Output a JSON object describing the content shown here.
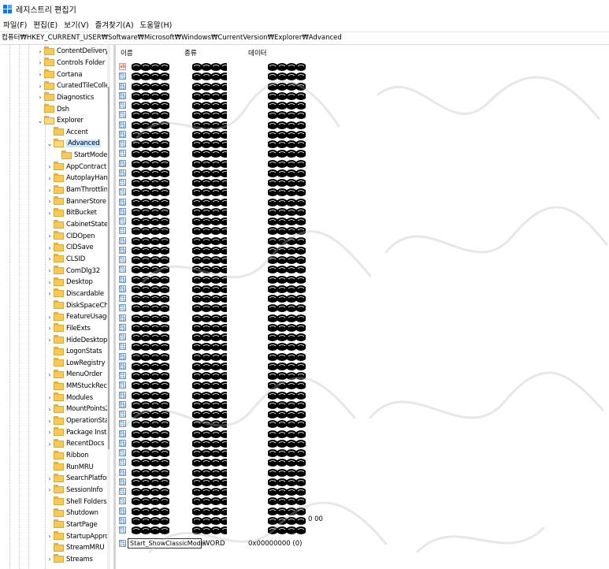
{
  "window": {
    "title": "레지스트리 편집기",
    "icon": "regedit-icon"
  },
  "menu": [
    "파일(F)",
    "편집(E)",
    "보기(V)",
    "즐겨찾기(A)",
    "도움말(H)"
  ],
  "address": "컴퓨터₩HKEY_CURRENT_USER₩Software₩Microsoft₩Windows₩CurrentVersion₩Explorer₩Advanced",
  "tree": [
    {
      "label": "ContentDeliveryM",
      "depth": 1,
      "arrow": "collapsed"
    },
    {
      "label": "Controls Folder (",
      "depth": 1,
      "arrow": "collapsed"
    },
    {
      "label": "Cortana",
      "depth": 1,
      "arrow": "collapsed"
    },
    {
      "label": "CuratedTileCollec",
      "depth": 1,
      "arrow": "collapsed"
    },
    {
      "label": "Diagnostics",
      "depth": 1,
      "arrow": "collapsed"
    },
    {
      "label": "Dsh",
      "depth": 1,
      "arrow": "none"
    },
    {
      "label": "Explorer",
      "depth": 1,
      "arrow": "expanded"
    },
    {
      "label": "Accent",
      "depth": 2,
      "arrow": "none"
    },
    {
      "label": "Advanced",
      "depth": 2,
      "arrow": "expanded",
      "selected": true
    },
    {
      "label": "StartMode",
      "depth": 3,
      "arrow": "none"
    },
    {
      "label": "AppContract",
      "depth": 2,
      "arrow": "collapsed"
    },
    {
      "label": "AutoplayHand",
      "depth": 2,
      "arrow": "collapsed"
    },
    {
      "label": "BamThrottling",
      "depth": 2,
      "arrow": "collapsed"
    },
    {
      "label": "BannerStore",
      "depth": 2,
      "arrow": "collapsed"
    },
    {
      "label": "BitBucket",
      "depth": 2,
      "arrow": "collapsed"
    },
    {
      "label": "CabinetState",
      "depth": 2,
      "arrow": "none"
    },
    {
      "label": "CIDOpen",
      "depth": 2,
      "arrow": "collapsed"
    },
    {
      "label": "CIDSave",
      "depth": 2,
      "arrow": "collapsed"
    },
    {
      "label": "CLSID",
      "depth": 2,
      "arrow": "collapsed"
    },
    {
      "label": "ComDlg32",
      "depth": 2,
      "arrow": "collapsed"
    },
    {
      "label": "Desktop",
      "depth": 2,
      "arrow": "collapsed"
    },
    {
      "label": "Discardable",
      "depth": 2,
      "arrow": "collapsed"
    },
    {
      "label": "DiskSpaceChe",
      "depth": 2,
      "arrow": "none"
    },
    {
      "label": "FeatureUsage",
      "depth": 2,
      "arrow": "collapsed"
    },
    {
      "label": "FileExts",
      "depth": 2,
      "arrow": "collapsed"
    },
    {
      "label": "HideDesktopI",
      "depth": 2,
      "arrow": "collapsed"
    },
    {
      "label": "LogonStats",
      "depth": 2,
      "arrow": "none"
    },
    {
      "label": "LowRegistry",
      "depth": 2,
      "arrow": "none"
    },
    {
      "label": "MenuOrder",
      "depth": 2,
      "arrow": "collapsed"
    },
    {
      "label": "MMStuckRect",
      "depth": 2,
      "arrow": "none"
    },
    {
      "label": "Modules",
      "depth": 2,
      "arrow": "collapsed"
    },
    {
      "label": "MountPoints2",
      "depth": 2,
      "arrow": "collapsed"
    },
    {
      "label": "OperationStat",
      "depth": 2,
      "arrow": "collapsed"
    },
    {
      "label": "Package Insta",
      "depth": 2,
      "arrow": "collapsed"
    },
    {
      "label": "RecentDocs",
      "depth": 2,
      "arrow": "collapsed"
    },
    {
      "label": "Ribbon",
      "depth": 2,
      "arrow": "none"
    },
    {
      "label": "RunMRU",
      "depth": 2,
      "arrow": "none"
    },
    {
      "label": "SearchPlatforn",
      "depth": 2,
      "arrow": "collapsed"
    },
    {
      "label": "SessionInfo",
      "depth": 2,
      "arrow": "collapsed"
    },
    {
      "label": "Shell Folders",
      "depth": 2,
      "arrow": "none"
    },
    {
      "label": "Shutdown",
      "depth": 2,
      "arrow": "none"
    },
    {
      "label": "StartPage",
      "depth": 2,
      "arrow": "none"
    },
    {
      "label": "StartupApprov",
      "depth": 2,
      "arrow": "collapsed"
    },
    {
      "label": "StreamMRU",
      "depth": 2,
      "arrow": "none"
    },
    {
      "label": "Streams",
      "depth": 2,
      "arrow": "collapsed"
    }
  ],
  "columns": {
    "name": "이름",
    "type": "종류",
    "data": "데이터"
  },
  "rows": {
    "count": 49,
    "first_icon": "string-value-icon",
    "icon": "dword-value-icon",
    "redaction": "redaction-scribble"
  },
  "edit": {
    "name": "Start_ShowClassicMode",
    "type": "WORD",
    "data": "0x00000000 (0)"
  },
  "tail_data": "0 00",
  "colors": {
    "selection": "#cce8ff",
    "folder": "#f7c85a",
    "icon_blue": "#2d6bc4"
  }
}
